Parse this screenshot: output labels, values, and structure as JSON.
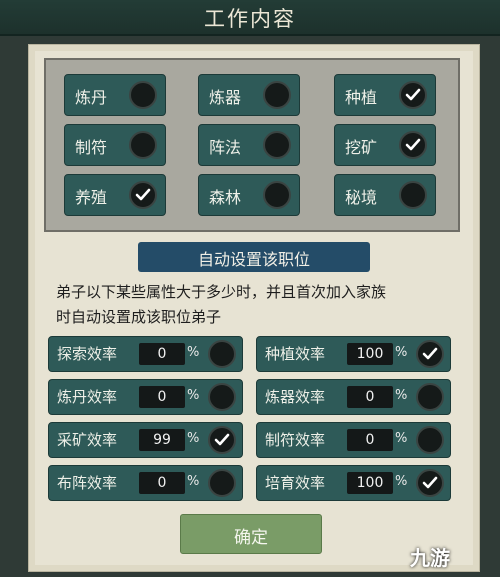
{
  "title": "工作内容",
  "work_types": [
    {
      "label": "炼丹",
      "checked": false
    },
    {
      "label": "炼器",
      "checked": false
    },
    {
      "label": "种植",
      "checked": true
    },
    {
      "label": "制符",
      "checked": false
    },
    {
      "label": "阵法",
      "checked": false
    },
    {
      "label": "挖矿",
      "checked": true
    },
    {
      "label": "养殖",
      "checked": true
    },
    {
      "label": "森林",
      "checked": false
    },
    {
      "label": "秘境",
      "checked": false
    }
  ],
  "auto_set_title": "自动设置该职位",
  "description_line1": "弟子以下某些属性大于多少时，并且首次加入家族",
  "description_line2": "时自动设置成该职位弟子",
  "attributes": [
    {
      "label": "探索效率",
      "value": "0",
      "unit": "%",
      "checked": false
    },
    {
      "label": "种植效率",
      "value": "100",
      "unit": "%",
      "checked": true
    },
    {
      "label": "炼丹效率",
      "value": "0",
      "unit": "%",
      "checked": false
    },
    {
      "label": "炼器效率",
      "value": "0",
      "unit": "%",
      "checked": false
    },
    {
      "label": "采矿效率",
      "value": "99",
      "unit": "%",
      "checked": true
    },
    {
      "label": "制符效率",
      "value": "0",
      "unit": "%",
      "checked": false
    },
    {
      "label": "布阵效率",
      "value": "0",
      "unit": "%",
      "checked": false
    },
    {
      "label": "培育效率",
      "value": "100",
      "unit": "%",
      "checked": true
    }
  ],
  "confirm_label": "确定",
  "watermark": "九游"
}
